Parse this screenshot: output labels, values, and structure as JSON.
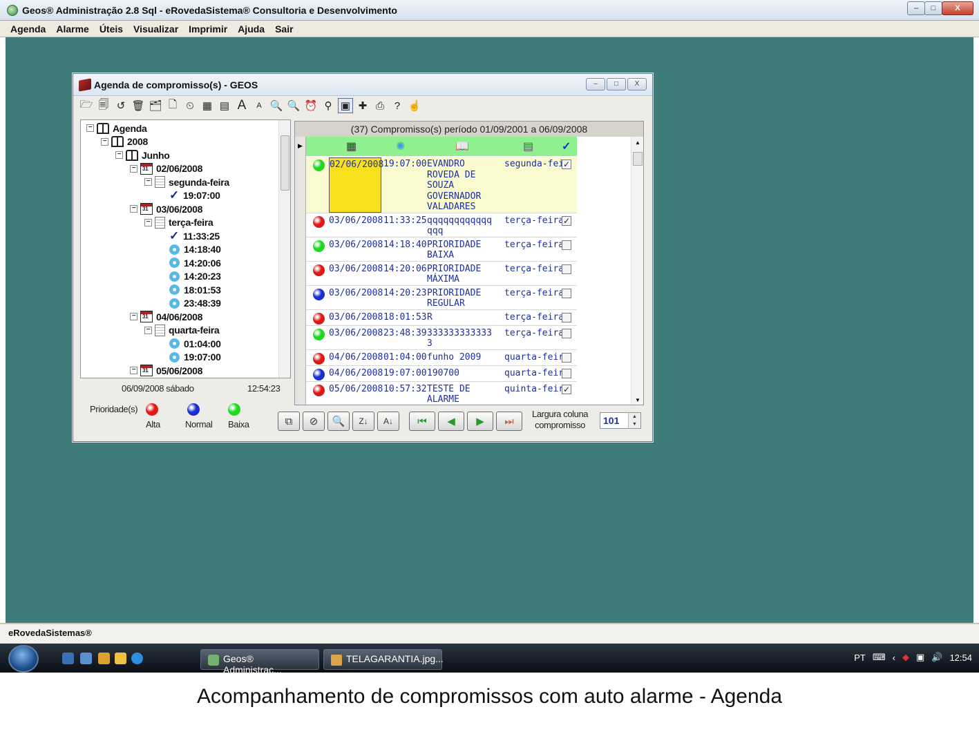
{
  "window": {
    "title": "Geos® Administração 2.8 Sql - eRovedaSistema® Consultoria e Desenvolvimento",
    "minimize": "–",
    "maximize": "□",
    "close": "X"
  },
  "menu": [
    "Agenda",
    "Alarme",
    "Úteis",
    "Visualizar",
    "Imprimir",
    "Ajuda",
    "Sair"
  ],
  "child": {
    "title": "Agenda de compromisso(s) - GEOS",
    "toolbar": [
      "open-icon",
      "save-icon",
      "undo-icon",
      "delete-icon",
      "folder-icon",
      "new-page-icon",
      "clock-icon",
      "calculator-icon",
      "calendar-icon",
      "font-larger-icon",
      "font-smaller-icon",
      "zoom-out-icon",
      "zoom-in-icon",
      "alarm-icon",
      "tree-icon",
      "record-icon",
      "remove-alarm-icon",
      "print-icon",
      "help-icon",
      "hand-icon"
    ],
    "toolbar_glyphs": [
      "🗁",
      "🗐",
      "↺",
      "🗑",
      "🗂",
      "🗋",
      "⏲",
      "▦",
      "▤",
      "A",
      "A",
      "🔍",
      "🔍",
      "⏰",
      "⚲",
      "▣",
      "✚",
      "⎙",
      "?",
      "☝"
    ]
  },
  "tree": [
    {
      "label": "Agenda",
      "icon": "book",
      "level": 0
    },
    {
      "label": "2008",
      "icon": "book",
      "level": 1
    },
    {
      "label": "Junho",
      "icon": "book",
      "level": 2
    },
    {
      "label": "02/06/2008",
      "icon": "calendar",
      "level": 3
    },
    {
      "label": "segunda-feira",
      "icon": "page",
      "level": 4
    },
    {
      "label": "19:07:00",
      "icon": "check",
      "level": 5
    },
    {
      "label": "03/06/2008",
      "icon": "calendar",
      "level": 3
    },
    {
      "label": "terça-feira",
      "icon": "page",
      "level": 4
    },
    {
      "label": "11:33:25",
      "icon": "check",
      "level": 5
    },
    {
      "label": "14:18:40",
      "icon": "alarm",
      "level": 5
    },
    {
      "label": "14:20:06",
      "icon": "alarm",
      "level": 5
    },
    {
      "label": "14:20:23",
      "icon": "alarm",
      "level": 5
    },
    {
      "label": "18:01:53",
      "icon": "alarm",
      "level": 5
    },
    {
      "label": "23:48:39",
      "icon": "alarm",
      "level": 5
    },
    {
      "label": "04/06/2008",
      "icon": "calendar",
      "level": 3
    },
    {
      "label": "quarta-feira",
      "icon": "page",
      "level": 4
    },
    {
      "label": "01:04:00",
      "icon": "alarm",
      "level": 5
    },
    {
      "label": "19:07:00",
      "icon": "alarm",
      "level": 5
    },
    {
      "label": "05/06/2008",
      "icon": "calendar",
      "level": 3
    }
  ],
  "status": {
    "date": "06/09/2008 sábado",
    "time": "12:54:23"
  },
  "priority": {
    "label": "Prioridade(s)",
    "items": [
      {
        "name": "Alta",
        "color": "#e01818"
      },
      {
        "name": "Normal",
        "color": "#1a2fd0"
      },
      {
        "name": "Baixa",
        "color": "#1fd81f"
      }
    ]
  },
  "grid": {
    "header": "(37) Compromisso(s) período 01/09/2001 a 06/09/2008",
    "columns": [
      "calendar-icon",
      "alarm-icon",
      "book-icon",
      "page-icon",
      "check-icon"
    ],
    "rows": [
      {
        "prio": "#1fd81f",
        "date": "02/06/2008",
        "time": "19:07:00",
        "desc": [
          "EVANDRO",
          "ROVEDA DE",
          "SOUZA",
          "GOVERNADOR",
          "VALADARES"
        ],
        "day": "segunda-fei",
        "done": true,
        "selected": true
      },
      {
        "prio": "#e01818",
        "date": "03/06/2008",
        "time": "11:33:25",
        "desc": [
          "qqqqqqqqqqqq",
          "qqq"
        ],
        "day": "terça-feira",
        "done": true
      },
      {
        "prio": "#1fd81f",
        "date": "03/06/2008",
        "time": "14:18:40",
        "desc": [
          "PRIORIDADE",
          "BAIXA"
        ],
        "day": "terça-feira",
        "done": false
      },
      {
        "prio": "#e01818",
        "date": "03/06/2008",
        "time": "14:20:06",
        "desc": [
          "PRIORIDADE",
          "MÁXIMA"
        ],
        "day": "terça-feira",
        "done": false
      },
      {
        "prio": "#1a2fd0",
        "date": "03/06/2008",
        "time": "14:20:23",
        "desc": [
          "PRIORIDADE",
          "REGULAR"
        ],
        "day": "terça-feira",
        "done": false
      },
      {
        "prio": "#e01818",
        "date": "03/06/2008",
        "time": "18:01:53",
        "desc": [
          "R"
        ],
        "day": "terça-feira",
        "done": false
      },
      {
        "prio": "#1fd81f",
        "date": "03/06/2008",
        "time": "23:48:39",
        "desc": [
          "333333333333",
          "3"
        ],
        "day": "terça-feira",
        "done": false
      },
      {
        "prio": "#e01818",
        "date": "04/06/2008",
        "time": "01:04:00",
        "desc": [
          "funho 2009"
        ],
        "day": "quarta-feira",
        "done": false
      },
      {
        "prio": "#1a2fd0",
        "date": "04/06/2008",
        "time": "19:07:00",
        "desc": [
          "190700"
        ],
        "day": "quarta-feira",
        "done": false
      },
      {
        "prio": "#e01818",
        "date": "05/06/2008",
        "time": "10:57:32",
        "desc": [
          "TESTE DE",
          "ALARME"
        ],
        "day": "quinta-feira",
        "done": true
      }
    ]
  },
  "nav": [
    "new-window-icon",
    "compass-icon",
    "search-icon",
    "sort-za-icon",
    "sort-az-icon",
    "first-icon",
    "prev-icon",
    "next-icon",
    "last-icon"
  ],
  "nav_glyphs": [
    "⧉",
    "⊘",
    "🔍",
    "Z↓",
    "A↓",
    "⏮",
    "◀",
    "▶",
    "⏭"
  ],
  "column_width": {
    "label1": "Largura coluna",
    "label2": "compromisso",
    "value": "101"
  },
  "statusbar": "eRovedaSistemas®",
  "taskbar": {
    "items": [
      "Geos® Administraç...",
      "TELAGARANTIA.jpg..."
    ],
    "lang": "PT",
    "clock": "12:54"
  },
  "caption": "Acompanhamento de compromissos com  auto alarme - Agenda"
}
